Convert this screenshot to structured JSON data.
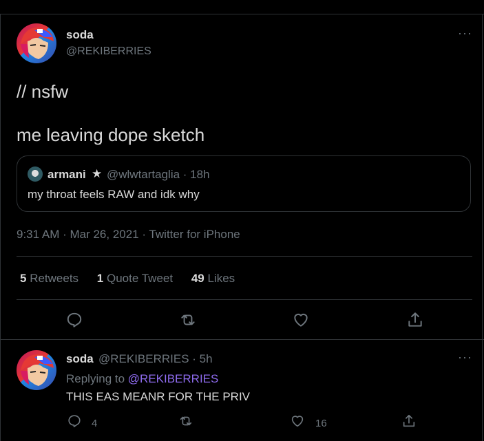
{
  "tweet": {
    "author_name": "soda",
    "author_handle": "@REKIBERRIES",
    "more_icon": "···",
    "line1": "// nsfw",
    "line2": "me leaving dope sketch",
    "quote": {
      "name": "armani",
      "star": "★",
      "handle_time": "@wlwtartaglia · 18h",
      "text": "my throat feels RAW and idk why"
    },
    "meta": "9:31 AM · Mar 26, 2021 · Twitter for iPhone",
    "stats": {
      "retweets_count": "5",
      "retweets_label": " Retweets",
      "quotes_count": "1",
      "quotes_label": " Quote Tweet",
      "likes_count": "49",
      "likes_label": " Likes"
    }
  },
  "reply": {
    "author_name": "soda",
    "handle_time": "@REKIBERRIES · 5h",
    "replying_prefix": "Replying to ",
    "replying_handle": "@REKIBERRIES",
    "text": "THIS EAS MEANR FOR THE PRIV",
    "reply_count": "4",
    "like_count": "16",
    "more_icon": "···"
  },
  "colors": {
    "background": "#000000",
    "text": "#d9d9d9",
    "muted": "#6e767d",
    "link": "#8f6cf0",
    "border": "#2f3336"
  }
}
